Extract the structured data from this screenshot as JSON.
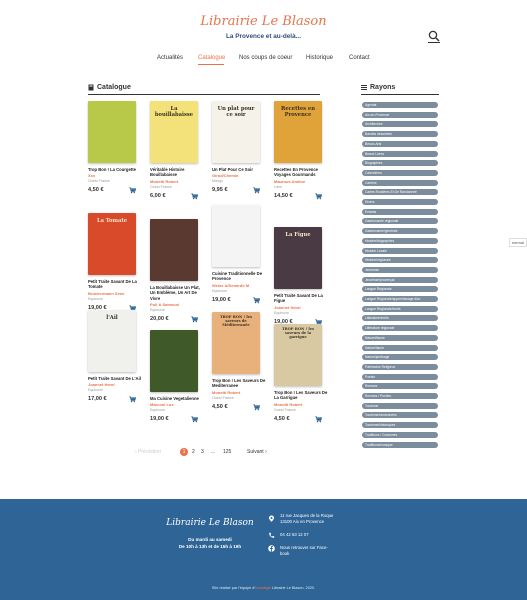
{
  "header": {
    "logo": "Librairie Le Blason",
    "tagline": "La Provence et au-delà..."
  },
  "nav": {
    "items": [
      "Actualités",
      "Catalogue",
      "Nos coups de coeur",
      "Historique",
      "Contact"
    ],
    "active": "Catalogue"
  },
  "catalogue": {
    "title": "Catalogue",
    "books": [
      {
        "title": "Trop Bon ! La Courgette",
        "author": "Xxx",
        "publisher": "Ouest France",
        "price": "4,50 €",
        "cover_text": "",
        "cover_bg": "#b8c94a"
      },
      {
        "title": "Véritable Histoire Bouillabaisse",
        "author": "Monetti Robert",
        "publisher": "Ouest France",
        "price": "6,00 €",
        "cover_text": "La bouillabaisse",
        "cover_bg": "#f3e27a"
      },
      {
        "title": "Un Plat Pour Ce Soir",
        "author": "Girod/Chemin",
        "publisher": "Mango",
        "price": "9,95 €",
        "cover_text": "Un plat pour ce soir",
        "cover_bg": "#f5f2ea"
      },
      {
        "title": "Recettes En Provence Voyages Gourmands",
        "author": "Maurous Andine",
        "publisher": "Libre",
        "price": "14,50 €",
        "cover_text": "Recettes en Provence",
        "cover_bg": "#e0a33a"
      },
      {
        "title": "Petit Traite Savant De La Tomate",
        "author": "Bruckermann Sven",
        "publisher": "Equinoxe",
        "price": "19,00 €",
        "cover_text": "La Tomate",
        "cover_bg": "#d84a2a"
      },
      {
        "title": "La Bouillabaisse Un Plat, Un Emblème, Un Art De Vivre",
        "author": "Poli & Samsoni",
        "publisher": "Equinoxe",
        "price": "20,00 €",
        "cover_text": "",
        "cover_bg": "#5a3a30"
      },
      {
        "title": "Cuisine Traditionnelle De Provence",
        "author": "Weiss A/Demirdö M",
        "publisher": "Equinoxe",
        "price": "19,00 €",
        "cover_text": "",
        "cover_bg": "#f4f4f4"
      },
      {
        "title": "Petit Traite Savant De La Figue",
        "author": "Joannet Henri",
        "publisher": "Equinoxe",
        "price": "19,00 €",
        "cover_text": "La Figue",
        "cover_bg": "#4a3a44"
      },
      {
        "title": "Petit Traite Savant De L'Ail",
        "author": "Joannet Henri",
        "publisher": "Equinoxe",
        "price": "17,00 €",
        "cover_text": "l'Ail",
        "cover_bg": "#f0f0ec"
      },
      {
        "title": "Ma Cuisine Vegetalienne",
        "author": "Marconi Lus",
        "publisher": "Equinoxe",
        "price": "19,00 €",
        "cover_text": "",
        "cover_bg": "#3f5a28"
      },
      {
        "title": "Trop Bon ! Les Saveurs De Mediterranee",
        "author": "Monetti Robert",
        "publisher": "Ouest France",
        "price": "4,50 €",
        "cover_text": "TROP BON ! les saveurs de Méditerranée",
        "cover_bg": "#e8b07a"
      },
      {
        "title": "Trop Bon ! Les Saveurs De La Garrigue",
        "author": "Monetti Robert",
        "publisher": "Ouest France",
        "price": "4,50 €",
        "cover_text": "TROP BON ! les saveurs de la garrigue",
        "cover_bg": "#d9c9a2"
      }
    ]
  },
  "pagination": {
    "prev": "‹ Précédent",
    "pages": [
      "1",
      "2",
      "3",
      "...",
      "125"
    ],
    "active": "1",
    "next": "Suivant ›"
  },
  "sidebar": {
    "title": "Rayons",
    "items": [
      "Agenda",
      "Aix-en-Provence",
      "Architecture",
      "Bandes dessinées",
      "Beaux-Arts",
      "Beaux Livres",
      "Biographies",
      "Calendriers",
      "Carterie",
      "Cartes Routières Et De Randonnée",
      "Divers",
      "Enfants",
      "Gastronomie régionale",
      "Gastronomie/générale",
      "Histoire/biographies",
      "Histoire Locale",
      "Histoire/régionale",
      "Jeunesse",
      "Jeunesse/provençal",
      "Langue Régionale",
      "Langue Régionale/apprentissage dico",
      "Langue Régionale/écrits",
      "Littérature/écrits",
      "Littérature régionale",
      "Naturel/faune",
      "Nature/faune",
      "Nature/jardinage",
      "Patrimoine Religieux",
      "Poésie",
      "Romans",
      "Romans / Poches",
      "Tourisme",
      "Tourisme/randonnées",
      "Tourisme/historiques",
      "Traditions / Coutumes",
      "Traditions/musique"
    ]
  },
  "edge_label": "normal",
  "footer": {
    "logo": "Librairie Le Blason",
    "hours_line1": "Du mardi au samedi",
    "hours_line2": "De 10h à 13h et de 15h à 19h",
    "address_line1": "11 rue Jacques de la Roque",
    "address_line2": "13100 Aix en Provence",
    "phone": "04 42 63 12 07",
    "facebook_line1": "Nous retrouver sur Face-",
    "facebook_line2": "book",
    "credit_pre": "Site réalisé par l'équipe d'",
    "credit_link": "Nostalgie",
    "credit_post": " Librairie Le Blason, 2020."
  },
  "colors": {
    "accent": "#e8734a",
    "footer_bg": "#2e6496",
    "rayon_bg": "#7b8c9c"
  }
}
